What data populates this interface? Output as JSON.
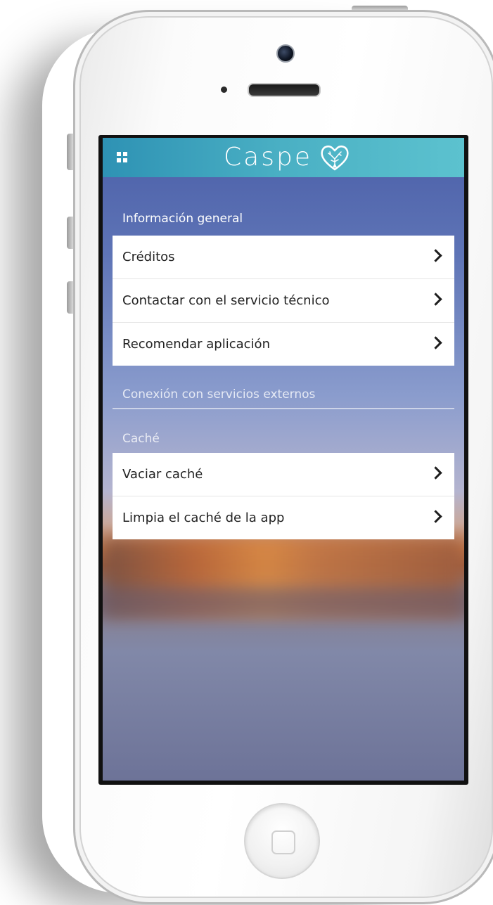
{
  "app": {
    "title": "Caspe",
    "brand_color": "#3fa6c0"
  },
  "sections": [
    {
      "label": "Información general",
      "items": [
        {
          "label": "Créditos",
          "icon": "chevron-right-icon"
        },
        {
          "label": "Contactar con el servicio técnico",
          "icon": "chevron-right-icon"
        },
        {
          "label": "Recomendar aplicación",
          "icon": "chevron-right-icon"
        }
      ]
    },
    {
      "label": "Conexión con servicios externos",
      "items": []
    },
    {
      "label": "Caché",
      "items": [
        {
          "label": "Vaciar caché",
          "icon": "chevron-right-icon"
        },
        {
          "label": "Limpia el caché de la app",
          "icon": "chevron-right-icon"
        }
      ]
    }
  ],
  "icons": {
    "menu": "grid-menu-icon",
    "logo": "heart-tree-logo-icon"
  }
}
